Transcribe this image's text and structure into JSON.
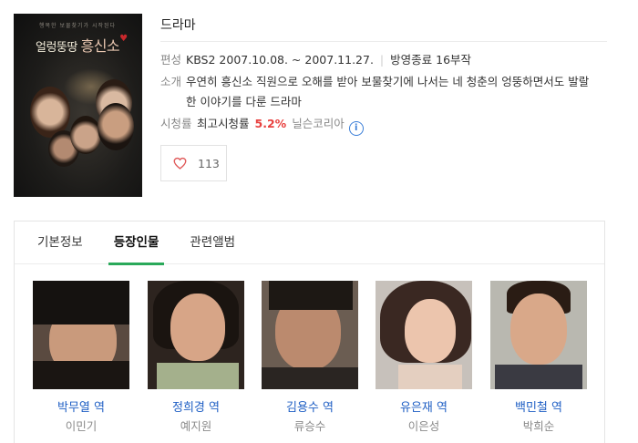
{
  "poster": {
    "title_small": "얼렁뚱땅",
    "title_big": "흥신소",
    "tagline": "행복한 보물찾기가 시작된다"
  },
  "drama": {
    "title": "드라마",
    "broadcast_label": "편성",
    "broadcast": "KBS2 2007.10.08. ~ 2007.11.27.",
    "status": "방영종료 16부작",
    "summary_label": "소개",
    "summary": "우연히 흥신소 직원으로 오해를 받아 보물찾기에 나서는 네 청춘의 엉뚱하면서도 발랄한 이야기를 다룬 드라마",
    "rating_label": "시청률",
    "rating_desc": "최고시청률",
    "rating_value": "5.2%",
    "rating_source": "닐슨코리아",
    "info_icon": "i"
  },
  "like": {
    "icon": "heart-icon",
    "count": "113"
  },
  "tabs": [
    {
      "label": "기본정보",
      "active": false
    },
    {
      "label": "등장인물",
      "active": true
    },
    {
      "label": "관련앨범",
      "active": false
    }
  ],
  "cast": [
    {
      "role": "박무열",
      "suffix": "역",
      "actor": "이민기"
    },
    {
      "role": "정희경",
      "suffix": "역",
      "actor": "예지원"
    },
    {
      "role": "김용수",
      "suffix": "역",
      "actor": "류승수"
    },
    {
      "role": "유은재",
      "suffix": "역",
      "actor": "이은성"
    },
    {
      "role": "백민철",
      "suffix": "역",
      "actor": "박희순"
    }
  ],
  "colors": {
    "accent_green": "#2aa95a",
    "link_blue": "#1f5fc4",
    "rating_red": "#e8413f"
  }
}
